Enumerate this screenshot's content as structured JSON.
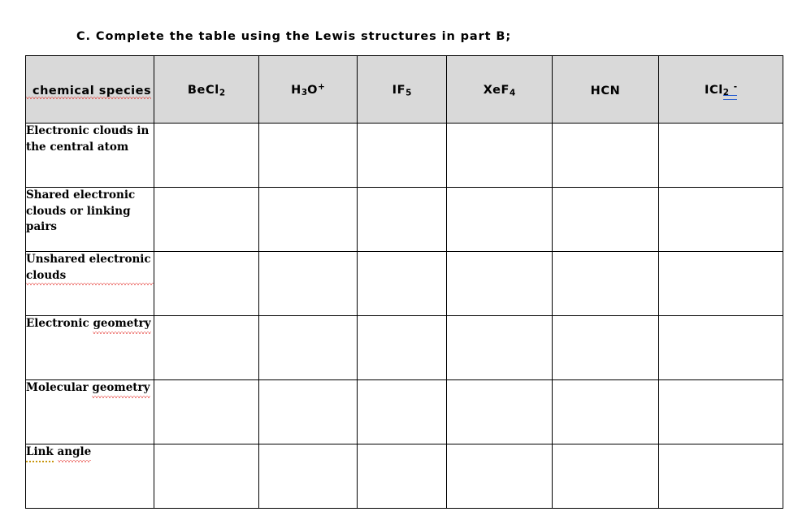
{
  "document": {
    "heading": "C.  Complete the table using the Lewis structures in part B;"
  },
  "table": {
    "header": {
      "row_label_header": "chemical species",
      "species": [
        {
          "id": "becl2",
          "base": "BeCl",
          "sub": "2",
          "sup": "",
          "plain": "BeCl2"
        },
        {
          "id": "h3o",
          "base": "H",
          "sub": "3",
          "sup": "",
          "tail": "O",
          "tail_sup": "+",
          "plain": "H3O+"
        },
        {
          "id": "if5",
          "base": "IF",
          "sub": "5",
          "sup": "",
          "plain": "IF5"
        },
        {
          "id": "xef4",
          "base": "XeF",
          "sub": "4",
          "sup": "",
          "plain": "XeF4"
        },
        {
          "id": "hcn",
          "base": "HCN",
          "sub": "",
          "sup": "",
          "plain": "HCN"
        },
        {
          "id": "icl2m",
          "base": "ICl",
          "sub": "2",
          "sup": "-",
          "plain": "ICl2-"
        }
      ]
    },
    "rows": [
      {
        "id": "electronic-clouds-central-atom",
        "label": "Electronic clouds in the central atom"
      },
      {
        "id": "shared-electronic-clouds",
        "label": "Shared electronic clouds or linking pairs"
      },
      {
        "id": "unshared-electronic-clouds",
        "label": "Unshared electronic clouds"
      },
      {
        "id": "electronic-geometry",
        "label_plain": "Electronic ",
        "label_marked": "geometry"
      },
      {
        "id": "molecular-geometry",
        "label_plain": "Molecular ",
        "label_marked": "geometry"
      },
      {
        "id": "link-angle",
        "label_word1": "Link",
        "label_word2": "angle"
      }
    ],
    "cells": {
      "empty": ""
    }
  },
  "colors": {
    "header_fill": "#d9d9d9",
    "border": "#000000",
    "page": "#ffffff",
    "spelling_underline": "#e01b15",
    "grammar_underline": "#2a5fd0",
    "style_underline": "#c8960c"
  }
}
